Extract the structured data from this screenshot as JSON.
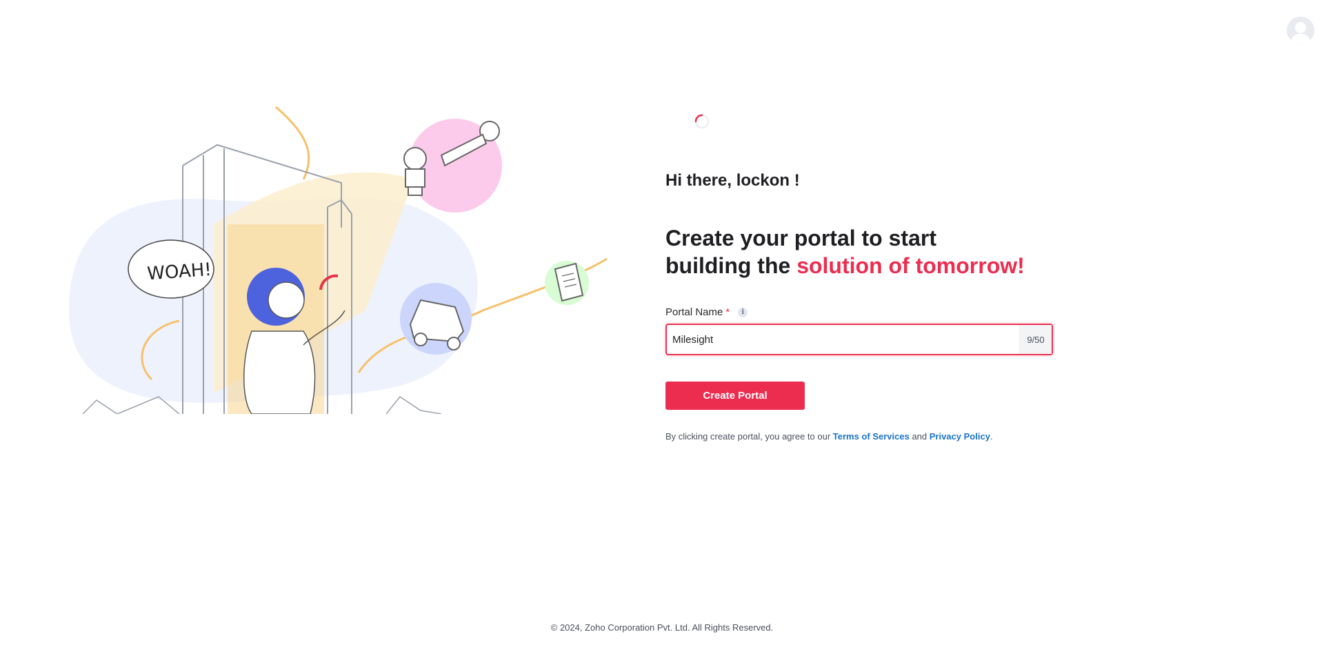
{
  "greeting": "Hi there, lockon !",
  "headline": {
    "line1": "Create your portal to start",
    "line2_prefix": "building the ",
    "line2_accent": "solution of tomorrow!"
  },
  "form": {
    "portal_label": "Portal Name",
    "required_mark": "*",
    "info_icon_glyph": "i",
    "portal_value": "Milesight",
    "char_count": "9/50",
    "submit_label": "Create Portal"
  },
  "terms": {
    "prefix": "By clicking create portal, you agree to our ",
    "terms_link": "Terms of Services",
    "and": " and ",
    "privacy_link": "Privacy Policy",
    "suffix": "."
  },
  "illustration": {
    "speech_bubble": "WOAH!"
  },
  "footer": {
    "copyright": "© 2024, Zoho Corporation Pvt. Ltd. All Rights Reserved."
  },
  "colors": {
    "accent": "#ec2d4f",
    "link": "#1a73c9",
    "text": "#1f1f23"
  },
  "icons": {
    "avatar": "user-avatar-icon",
    "info": "info-icon",
    "loader": "loading-spinner-icon"
  }
}
